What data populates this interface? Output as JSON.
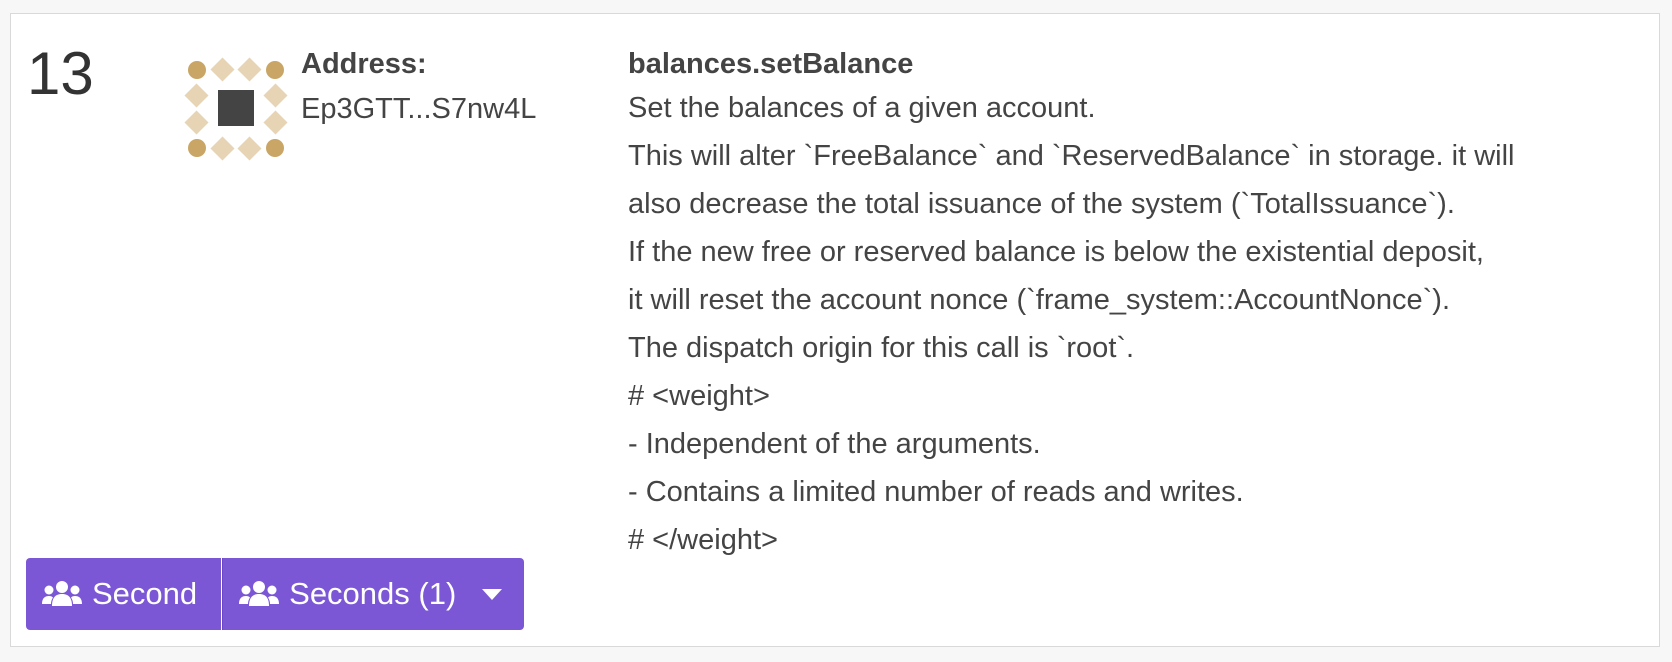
{
  "proposal": {
    "index": "13",
    "address_label": "Address:",
    "address_value": "Ep3GTT...S7nw4L",
    "call_name": "balances.setBalance",
    "doc_lines": [
      "Set the balances of a given account.",
      "This will alter `FreeBalance` and `ReservedBalance` in storage. it will",
      "also decrease the total issuance of the system (`TotalIssuance`).",
      "If the new free or reserved balance is below the existential deposit,",
      "it will reset the account nonce (`frame_system::AccountNonce`).",
      "The dispatch origin for this call is `root`.",
      "# <weight>",
      "- Independent of the arguments.",
      "- Contains a limited number of reads and writes.",
      "# </weight>"
    ]
  },
  "actions": {
    "second_label": "Second",
    "seconds_label": "Seconds (1)",
    "icon": "users-icon",
    "dropdown_icon": "caret-down-icon"
  },
  "colors": {
    "accent": "#7b57d6",
    "identicon_gold": "#c9a566",
    "identicon_beige": "#e6d4b5",
    "identicon_center": "#444444"
  }
}
